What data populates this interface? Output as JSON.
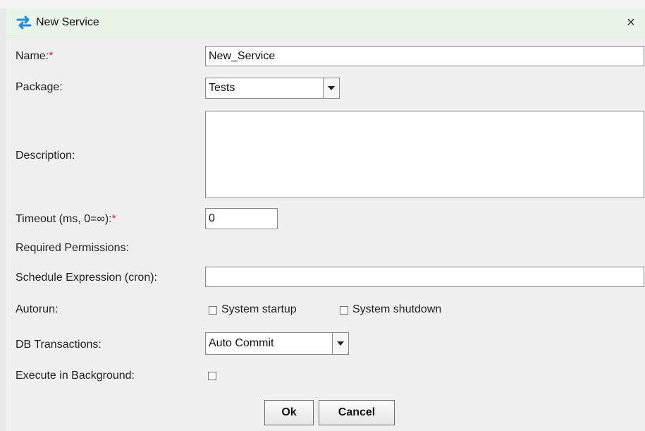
{
  "dialog": {
    "title": "New Service",
    "close_glyph": "×",
    "icon": "swap-arrows-icon"
  },
  "form": {
    "name_label": "Name:",
    "required_mark": "*",
    "name_value": "New_Service",
    "package_label": "Package:",
    "package_value": "Tests",
    "description_label": "Description:",
    "description_value": "",
    "timeout_label": "Timeout (ms, 0=∞):",
    "timeout_value": "0",
    "permissions_label": "Required Permissions:",
    "schedule_label": "Schedule Expression (cron):",
    "schedule_value": "",
    "autorun_label": "Autorun:",
    "autorun_options": [
      {
        "label": "System startup",
        "checked": false
      },
      {
        "label": "System shutdown",
        "checked": false
      }
    ],
    "db_label": "DB Transactions:",
    "db_value": "Auto Commit",
    "background_label": "Execute in Background:",
    "background_checked": false
  },
  "buttons": {
    "ok_label": "Ok",
    "cancel_label": "Cancel"
  },
  "colors": {
    "titlebar_bg": "#e9f5e9",
    "icon_blue": "#1e88e5",
    "required_red": "#e33333"
  }
}
